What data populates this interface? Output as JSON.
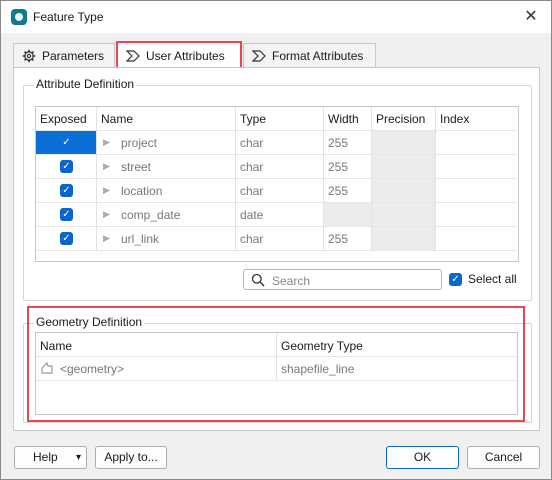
{
  "window": {
    "title": "Feature Type",
    "close_glyph": "✕"
  },
  "tabs": [
    {
      "label": "Parameters",
      "icon": "gear-icon"
    },
    {
      "label": "User Attributes",
      "icon": "user-attributes-icon"
    },
    {
      "label": "Format Attributes",
      "icon": "format-attributes-icon"
    }
  ],
  "attribute_definition": {
    "title": "Attribute Definition",
    "columns": [
      "Exposed",
      "Name",
      "Type",
      "Width",
      "Precision",
      "Index"
    ],
    "rows": [
      {
        "exposed": true,
        "name": "project",
        "type": "char",
        "width": "255"
      },
      {
        "exposed": true,
        "name": "street",
        "type": "char",
        "width": "255"
      },
      {
        "exposed": true,
        "name": "location",
        "type": "char",
        "width": "255"
      },
      {
        "exposed": true,
        "name": "comp_date",
        "type": "date",
        "width": ""
      },
      {
        "exposed": true,
        "name": "url_link",
        "type": "char",
        "width": "255"
      }
    ],
    "search_placeholder": "Search",
    "select_all_label": "Select all",
    "select_all_checked": true
  },
  "geometry_definition": {
    "title": "Geometry Definition",
    "columns": [
      "Name",
      "Geometry Type"
    ],
    "rows": [
      {
        "name": "<geometry>",
        "geometry_type": "shapefile_line"
      }
    ]
  },
  "buttons": {
    "help": "Help",
    "help_arrow": "▾",
    "apply": "Apply to...",
    "ok": "OK",
    "cancel": "Cancel"
  },
  "colors": {
    "accent": "#0a66c7",
    "highlight": "#e8474f"
  }
}
